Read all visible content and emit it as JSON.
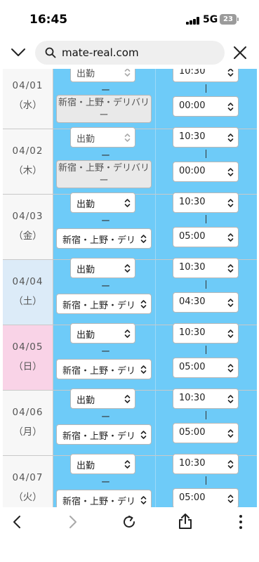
{
  "status_bar": {
    "time": "16:45",
    "network": "5G",
    "battery": "23"
  },
  "browser": {
    "url": "mate-real.com"
  },
  "schedule": {
    "rows": [
      {
        "date": "04/01",
        "weekday": "（水）",
        "type": "出勤",
        "area": "新宿・上野・デリバリー",
        "start": "10:30",
        "end": "00:00",
        "disabled": true,
        "day_kind": "weekday"
      },
      {
        "date": "04/02",
        "weekday": "（木）",
        "type": "出勤",
        "area": "新宿・上野・デリバリー",
        "start": "10:30",
        "end": "00:00",
        "disabled": true,
        "day_kind": "weekday"
      },
      {
        "date": "04/03",
        "weekday": "（金）",
        "type": "出勤",
        "area": "新宿・上野・デリバ",
        "start": "10:30",
        "end": "05:00",
        "disabled": false,
        "day_kind": "weekday"
      },
      {
        "date": "04/04",
        "weekday": "（土）",
        "type": "出勤",
        "area": "新宿・上野・デリバ",
        "start": "10:30",
        "end": "04:30",
        "disabled": false,
        "day_kind": "saturday"
      },
      {
        "date": "04/05",
        "weekday": "（日）",
        "type": "出勤",
        "area": "新宿・上野・デリバ",
        "start": "10:30",
        "end": "05:00",
        "disabled": false,
        "day_kind": "sunday"
      },
      {
        "date": "04/06",
        "weekday": "（月）",
        "type": "出勤",
        "area": "新宿・上野・デリバ",
        "start": "10:30",
        "end": "05:00",
        "disabled": false,
        "day_kind": "weekday"
      },
      {
        "date": "04/07",
        "weekday": "（火）",
        "type": "出勤",
        "area": "新宿・上野・デリバ",
        "start": "10:30",
        "end": "05:00",
        "disabled": false,
        "day_kind": "weekday"
      }
    ],
    "separator_dash": "ー"
  },
  "colors": {
    "cell_blue": "#6ecbf8",
    "saturday": "#dcebf8",
    "sunday": "#f9d3e7",
    "weekday": "#f7f7f7"
  },
  "icons": [
    "chevron-down-icon",
    "search-icon",
    "close-icon",
    "back-icon",
    "forward-icon",
    "reload-icon",
    "share-icon",
    "more-icon"
  ]
}
